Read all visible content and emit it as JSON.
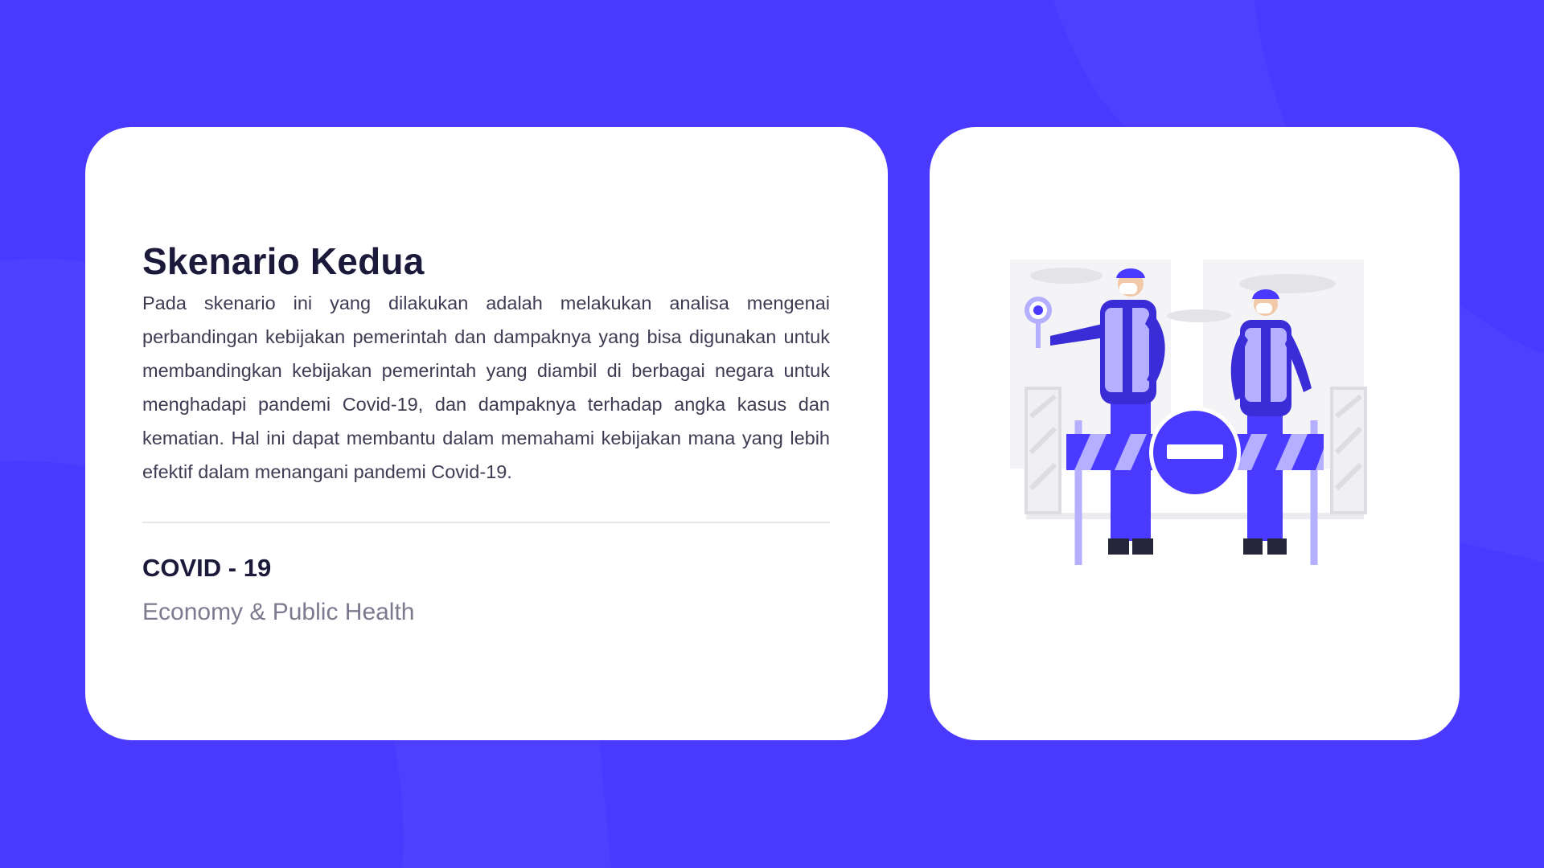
{
  "slide": {
    "title": "Skenario Kedua",
    "description": "Pada skenario ini yang dilakukan adalah melakukan analisa mengenai perbandingan kebijakan pemerintah dan dampaknya yang bisa digunakan untuk membandingkan kebijakan pemerintah yang diambil di berbagai negara untuk menghadapi pandemi Covid-19, dan dampaknya terhadap angka kasus dan kematian. Hal ini dapat membantu dalam memahami kebijakan mana yang lebih efektif dalam menangani pandemi Covid-19.",
    "topic": "COVID - 19",
    "tags": "Economy &  Public Health"
  },
  "colors": {
    "background": "#4a3aff",
    "card": "#ffffff",
    "title": "#1c1a3a",
    "body": "#3d3c52",
    "muted": "#7b7a8e",
    "accent": "#4a3aff",
    "accent_light": "#a9a4ff"
  },
  "illustration": {
    "icon": "road-barrier-guards-illustration"
  }
}
